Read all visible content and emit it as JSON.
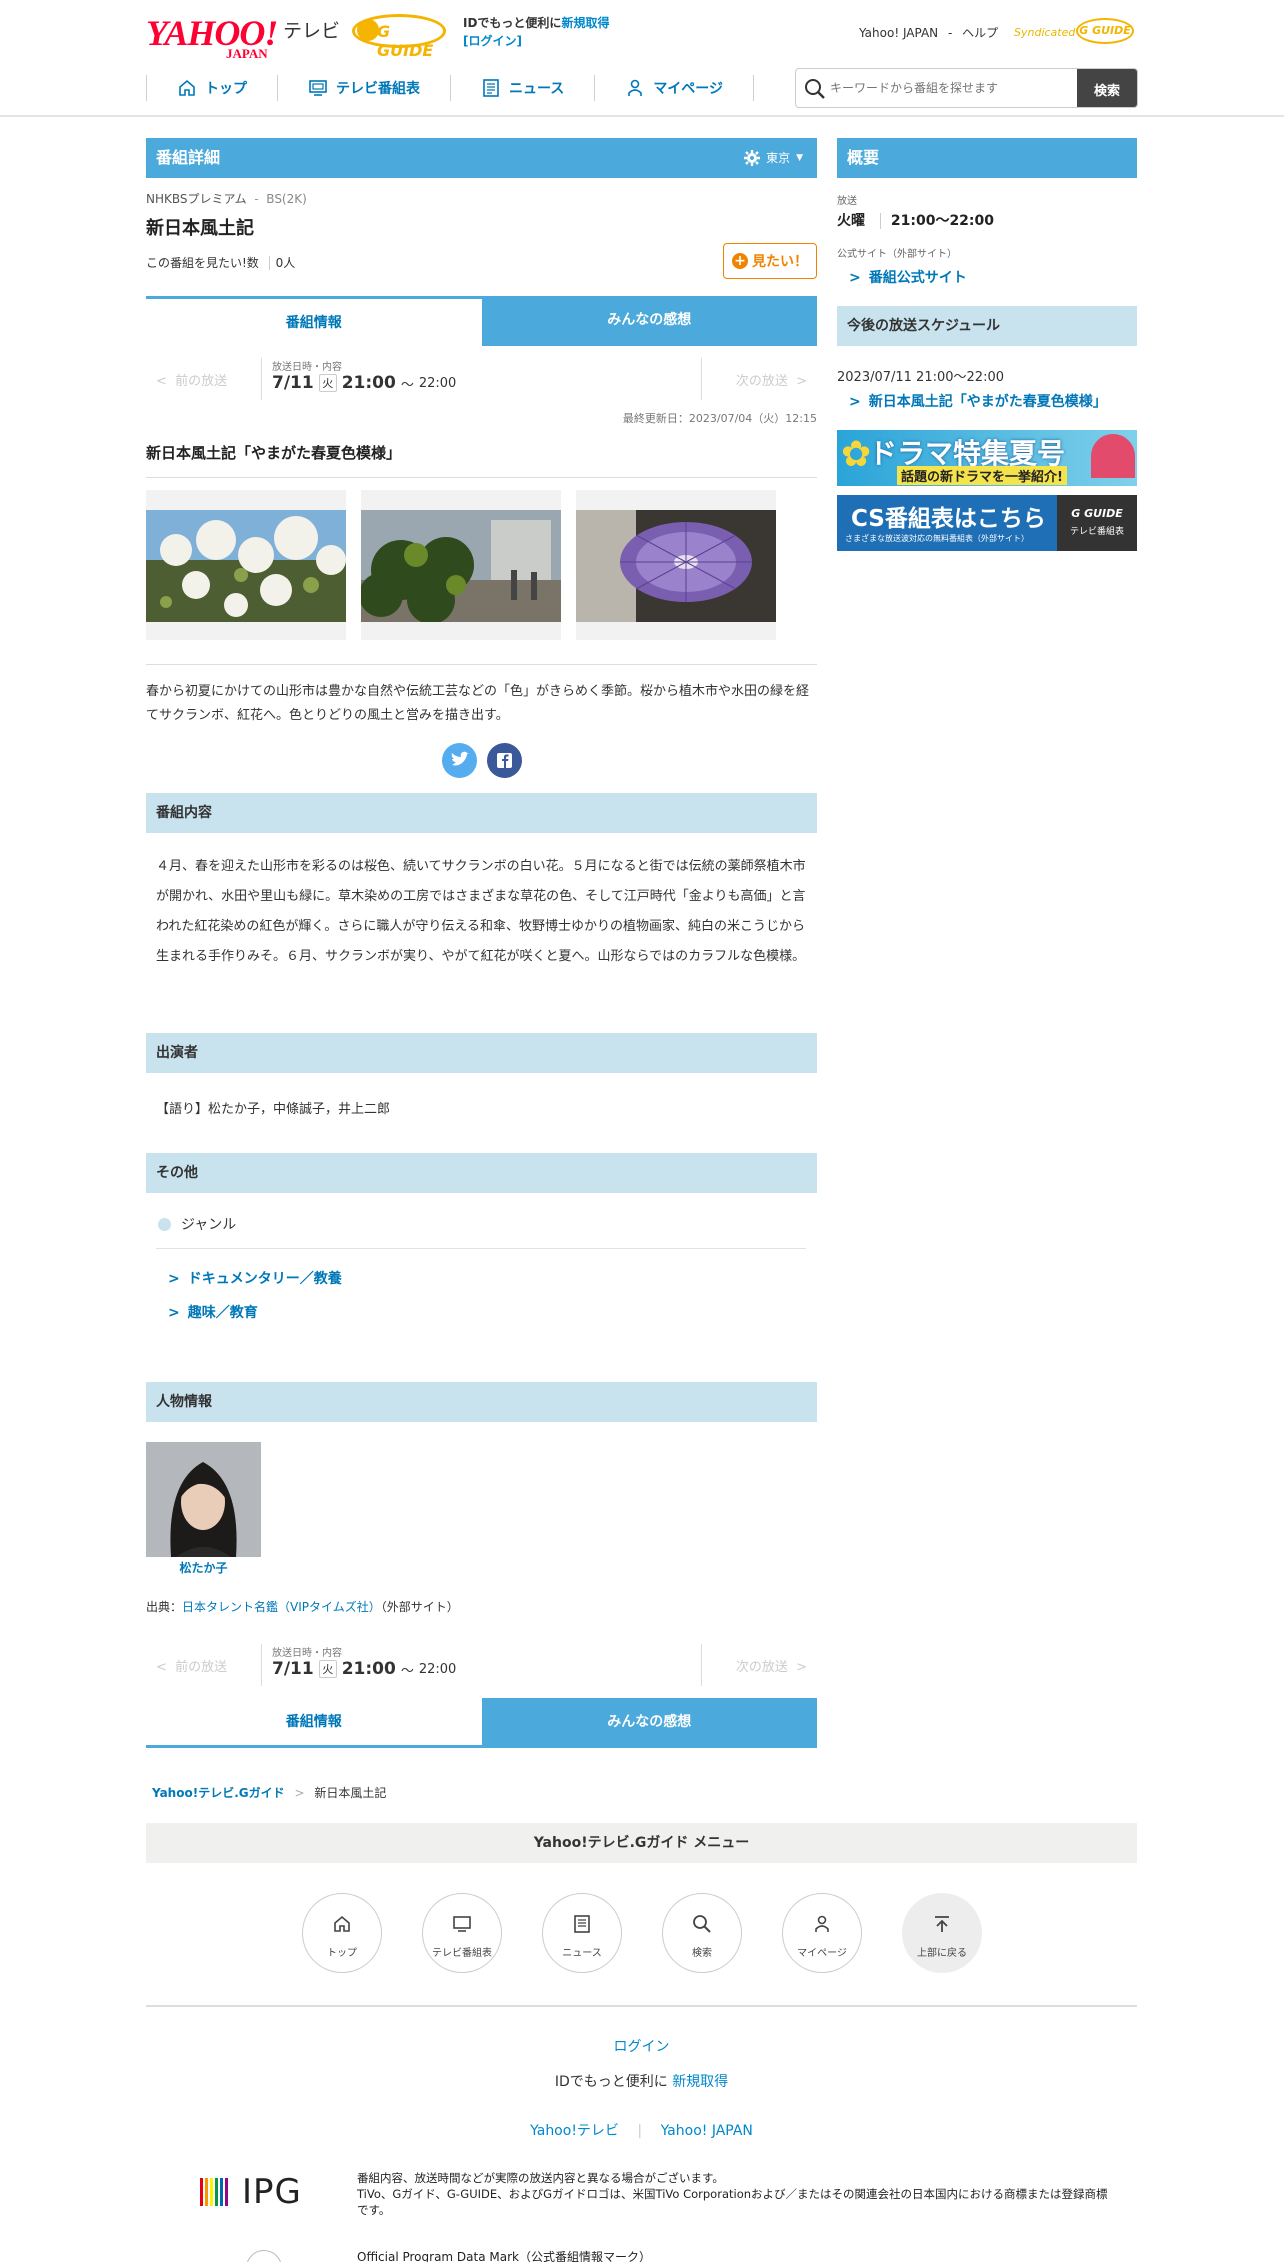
{
  "header": {
    "logo_yahoo": "YAHOO!",
    "logo_japan": "JAPAN",
    "logo_tv": "テレビ",
    "logo_gguide": "G GUIDE",
    "promo_text": "IDでもっと便利に",
    "promo_signup": "新規取得",
    "promo_login": "[ログイン]",
    "yahoo_japan": "Yahoo! JAPAN",
    "help": "ヘルプ",
    "syndicated": "Syndicated",
    "syndicated_logo": "G GUIDE"
  },
  "nav": {
    "items": [
      {
        "label": "トップ",
        "icon": "home-icon"
      },
      {
        "label": "テレビ番組表",
        "icon": "tv-icon"
      },
      {
        "label": "ニュース",
        "icon": "news-icon"
      },
      {
        "label": "マイページ",
        "icon": "user-icon"
      }
    ]
  },
  "search": {
    "placeholder": "キーワードから番組を探せます",
    "button": "検索"
  },
  "detail": {
    "section_title": "番組詳細",
    "region": "東京",
    "channel": "NHKBSプレミアム",
    "channel_sub": "BS(2K)",
    "program_title": "新日本風土記",
    "want_label": "この番組を見たい!数",
    "want_count": "0人",
    "want_button": "見たい！"
  },
  "tabs": {
    "info": "番組情報",
    "review": "みんなの感想"
  },
  "broadcast_nav": {
    "prev": "前の放送",
    "next": "次の放送",
    "label": "放送日時・内容",
    "date": "7/11",
    "dow": "火",
    "start": "21:00",
    "tilde": "〜",
    "end": "22:00"
  },
  "updated": "最終更新日：2023/07/04（火）12:15",
  "episode_title": "新日本風土記「やまがた春夏色模様」",
  "summary": "春から初夏にかけての山形市は豊かな自然や伝統工芸などの「色」がきらめく季節。桜から植木市や水田の緑を経てサクランボ、紅花へ。色とりどりの風土と営みを描き出す。",
  "content": {
    "heading": "番組内容",
    "text": "４月、春を迎えた山形市を彩るのは桜色、続いてサクランボの白い花。５月になると街では伝統の薬師祭植木市が開かれ、水田や里山も緑に。草木染めの工房ではさまざまな草花の色、そして江戸時代「金よりも高価」と言われた紅花染めの紅色が輝く。さらに職人が守り伝える和傘、牧野博士ゆかりの植物画家、純白の米こうじから生まれる手作りみそ。６月、サクランボが実り、やがて紅花が咲くと夏へ。山形ならではのカラフルな色模様。"
  },
  "cast": {
    "heading": "出演者",
    "text": "【語り】松たか子，中條誠子，井上二郎"
  },
  "other": {
    "heading": "その他",
    "genre_label": "ジャンル",
    "genres": [
      "ドキュメンタリー／教養",
      "趣味／教育"
    ]
  },
  "people": {
    "heading": "人物情報",
    "name": "松たか子",
    "source_label": "出典：",
    "source_link": "日本タレント名鑑（VIPタイムズ社）",
    "source_note": "（外部サイト）"
  },
  "breadcrumb": {
    "home": "Yahoo!テレビ.Gガイド",
    "current": "新日本風土記"
  },
  "menu": {
    "title": "Yahoo!テレビ.Gガイド メニュー",
    "items": [
      "トップ",
      "テレビ番組表",
      "ニュース",
      "検索",
      "マイページ",
      "上部に戻る"
    ]
  },
  "footer": {
    "login": "ログイン",
    "promo": "IDでもっと便利に",
    "signup": "新規取得",
    "link1": "Yahoo!テレビ",
    "link2": "Yahoo! JAPAN",
    "ipg": "IPG",
    "notice1": "番組内容、放送時間などが実際の放送内容と異なる場合がございます。",
    "notice2": "TiVo、Gガイド、G-GUIDE、およびGガイドロゴは、米国TiVo Corporationおよび／またはその関連会社の日本国内における商標または登録商標です。",
    "mark": "Official Program Data Mark（公式番組情報マーク）"
  },
  "sidebar": {
    "summary_title": "概要",
    "broadcast_label": "放送",
    "broadcast_day": "火曜",
    "broadcast_time": "21:00〜22:00",
    "official_label": "公式サイト（外部サイト）",
    "official_link": "番組公式サイト",
    "schedule_title": "今後の放送スケジュール",
    "schedule_date": "2023/07/11 21:00〜22:00",
    "schedule_link": "新日本風土記「やまがた春夏色模様」",
    "banner1_main": "ドラマ特集夏号",
    "banner1_sub": "話題の新ドラマを一挙紹介!",
    "banner2_main": "CS番組表はこちら",
    "banner2_sub": "さまざまな放送波対応の無料番組表（外部サイト）",
    "banner2_logo": "G GUIDE",
    "banner2_logo_sub": "テレビ番組表"
  },
  "colors": {
    "accent": "#4ba9db",
    "link": "#0078b8",
    "sub_bar": "#c8e2ee",
    "want_orange": "#f08300"
  }
}
